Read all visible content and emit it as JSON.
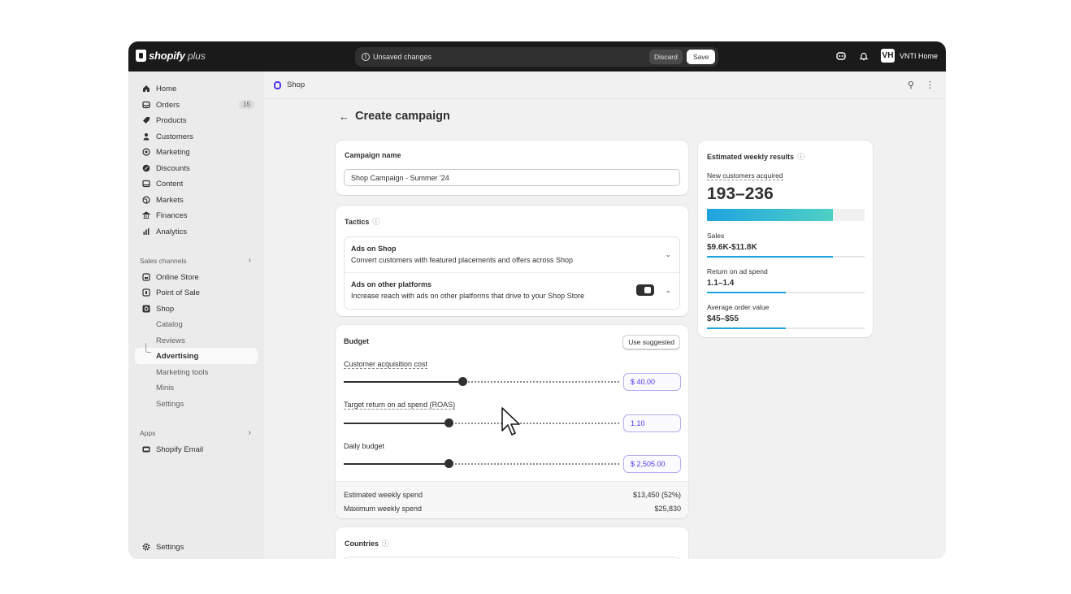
{
  "topbar": {
    "logo_text": "shopify",
    "logo_plus": "plus",
    "unsaved_text": "Unsaved changes",
    "discard_label": "Discard",
    "save_label": "Save",
    "store_initials": "VH",
    "store_name": "VNTI Home"
  },
  "sidebar": {
    "items": [
      {
        "label": "Home",
        "icon": "home-icon"
      },
      {
        "label": "Orders",
        "icon": "orders-icon",
        "badge": "15"
      },
      {
        "label": "Products",
        "icon": "tag-icon"
      },
      {
        "label": "Customers",
        "icon": "person-icon"
      },
      {
        "label": "Marketing",
        "icon": "target-icon"
      },
      {
        "label": "Discounts",
        "icon": "discount-icon"
      },
      {
        "label": "Content",
        "icon": "content-icon"
      },
      {
        "label": "Markets",
        "icon": "globe-icon"
      },
      {
        "label": "Finances",
        "icon": "bank-icon"
      },
      {
        "label": "Analytics",
        "icon": "bar-chart-icon"
      }
    ],
    "sales_channels_label": "Sales channels",
    "channels": [
      {
        "label": "Online Store",
        "icon": "store-icon"
      },
      {
        "label": "Point of Sale",
        "icon": "pos-icon"
      },
      {
        "label": "Shop",
        "icon": "shop-icon"
      }
    ],
    "shop_sub": [
      "Catalog",
      "Reviews",
      "Advertising",
      "Marketing tools",
      "Minis",
      "Settings"
    ],
    "apps_label": "Apps",
    "apps": [
      {
        "label": "Shopify Email",
        "icon": "email-icon"
      }
    ],
    "settings_label": "Settings"
  },
  "breadcrumb": {
    "label": "Shop"
  },
  "page": {
    "title": "Create campaign"
  },
  "campaign": {
    "title": "Campaign name",
    "name_value": "Shop Campaign - Summer '24"
  },
  "tactics": {
    "title": "Tactics",
    "items": [
      {
        "title": "Ads on Shop",
        "desc": "Convert customers with featured placements and offers across Shop"
      },
      {
        "title": "Ads on other platforms",
        "desc": "Increase reach with ads on other platforms that drive to your Shop Store",
        "toggle_on": true
      }
    ]
  },
  "budget": {
    "title": "Budget",
    "use_suggested": "Use suggested",
    "sliders": [
      {
        "label": "Customer acquisition cost",
        "value": "$ 40.00",
        "fraction": 0.43
      },
      {
        "label": "Target return on ad spend (ROAS)",
        "value": "1.10",
        "fraction": 0.38
      },
      {
        "label": "Daily budget",
        "value": "$ 2,505.00",
        "fraction": 0.38
      }
    ],
    "est_weekly_label": "Estimated weekly spend",
    "est_weekly_value": "$13,450 (52%)",
    "max_weekly_label": "Maximum weekly spend",
    "max_weekly_value": "$25,830"
  },
  "countries": {
    "title": "Countries"
  },
  "results": {
    "title": "Estimated weekly results",
    "new_customers_label": "New customers acquired",
    "new_customers_value": "193–236",
    "new_customers_fraction": 0.8,
    "metrics": [
      {
        "label": "Sales",
        "value": "$9.6K-$11.8K",
        "fraction": 0.8
      },
      {
        "label": "Return on ad spend",
        "value": "1.1–1.4",
        "fraction": 0.5
      },
      {
        "label": "Average order value",
        "value": "$45–$55",
        "fraction": 0.5
      }
    ],
    "accent_gradient": [
      "#1fa3e0",
      "#4fd1c5"
    ]
  }
}
